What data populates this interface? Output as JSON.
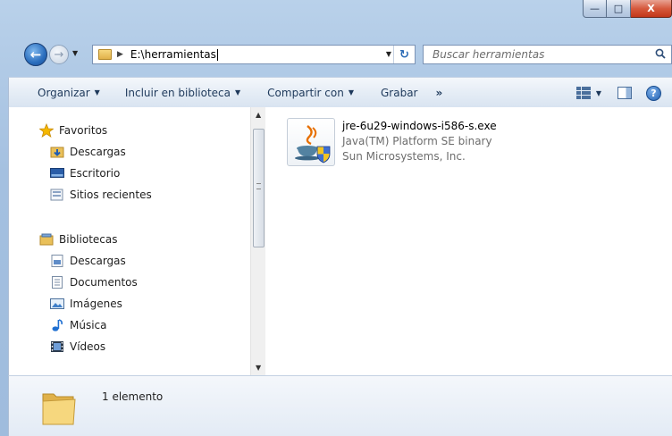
{
  "window": {
    "buttons": {
      "minimize": "—",
      "maximize": "□",
      "close": "X"
    }
  },
  "nav": {
    "back_glyph": "←",
    "forward_glyph": "→",
    "address": "E:\\herramientas",
    "refresh_glyph": "↻",
    "search_placeholder": "Buscar herramientas"
  },
  "toolbar": {
    "items": [
      {
        "label": "Organizar",
        "has_arrow": true
      },
      {
        "label": "Incluir en biblioteca",
        "has_arrow": true
      },
      {
        "label": "Compartir con",
        "has_arrow": true
      },
      {
        "label": "Grabar",
        "has_arrow": false
      },
      {
        "label": "»",
        "has_arrow": false
      }
    ],
    "help_glyph": "?"
  },
  "sidebar": {
    "favorites_label": "Favoritos",
    "favorites": [
      {
        "label": "Descargas",
        "icon": "downloads-icon"
      },
      {
        "label": "Escritorio",
        "icon": "desktop-icon"
      },
      {
        "label": "Sitios recientes",
        "icon": "recent-places-icon"
      }
    ],
    "libraries_label": "Bibliotecas",
    "libraries": [
      {
        "label": "Descargas",
        "icon": "downloads-library-icon"
      },
      {
        "label": "Documentos",
        "icon": "documents-icon"
      },
      {
        "label": "Imágenes",
        "icon": "pictures-icon"
      },
      {
        "label": "Música",
        "icon": "music-icon"
      },
      {
        "label": "Vídeos",
        "icon": "videos-icon"
      }
    ]
  },
  "files": [
    {
      "name": "jre-6u29-windows-i586-s.exe",
      "description": "Java(TM) Platform SE binary",
      "company": "Sun Microsystems, Inc.",
      "icon": "java-installer-icon"
    }
  ],
  "details": {
    "count_text": "1 elemento"
  },
  "colors": {
    "frame": "#a4c0e0",
    "toolbar_text": "#1e395b",
    "close_button": "#c2371a",
    "secondary_text": "#6d6d6d"
  }
}
